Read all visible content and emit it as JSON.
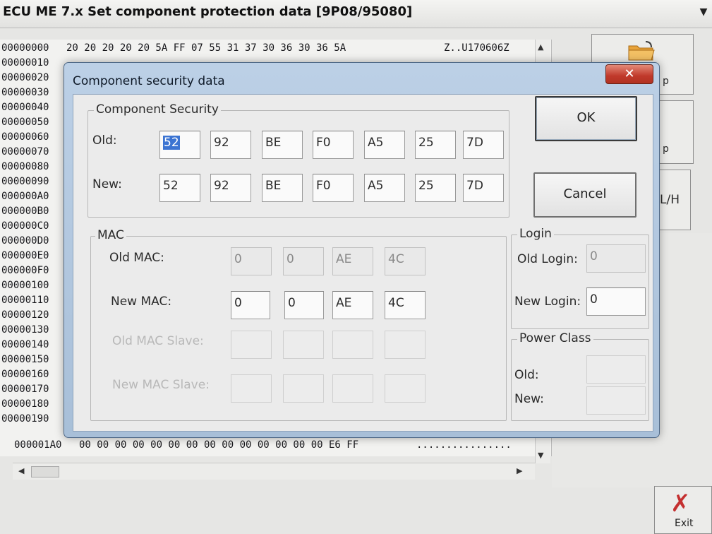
{
  "app": {
    "title": "ECU ME 7.x Set component protection data [9P08/95080]",
    "side_buttons": [
      {
        "label": "p"
      },
      {
        "label": "p"
      },
      {
        "label": "L/H"
      }
    ],
    "exit_label": "Exit"
  },
  "hex": {
    "rows": [
      {
        "addr": "00000000",
        "bytes": "20 20 20 20 20 5A FF 07 55 31 37 30 36 30 36 5A",
        "ascii": "Z..U170606Z"
      },
      {
        "addr": "00000010",
        "bytes": "",
        "ascii": ""
      },
      {
        "addr": "00000020",
        "bytes": "",
        "ascii": ""
      },
      {
        "addr": "00000030",
        "bytes": "",
        "ascii": ""
      },
      {
        "addr": "00000040",
        "bytes": "",
        "ascii": ""
      },
      {
        "addr": "00000050",
        "bytes": "",
        "ascii": ""
      },
      {
        "addr": "00000060",
        "bytes": "",
        "ascii": ""
      },
      {
        "addr": "00000070",
        "bytes": "",
        "ascii": ""
      },
      {
        "addr": "00000080",
        "bytes": "",
        "ascii": ""
      },
      {
        "addr": "00000090",
        "bytes": "",
        "ascii": ""
      },
      {
        "addr": "000000A0",
        "bytes": "",
        "ascii": ""
      },
      {
        "addr": "000000B0",
        "bytes": "",
        "ascii": ""
      },
      {
        "addr": "000000C0",
        "bytes": "",
        "ascii": ""
      },
      {
        "addr": "000000D0",
        "bytes": "",
        "ascii": ""
      },
      {
        "addr": "000000E0",
        "bytes": "",
        "ascii": ""
      },
      {
        "addr": "000000F0",
        "bytes": "",
        "ascii": ""
      },
      {
        "addr": "00000100",
        "bytes": "",
        "ascii": ""
      },
      {
        "addr": "00000110",
        "bytes": "",
        "ascii": ""
      },
      {
        "addr": "00000120",
        "bytes": "",
        "ascii": ""
      },
      {
        "addr": "00000130",
        "bytes": "",
        "ascii": ""
      },
      {
        "addr": "00000140",
        "bytes": "",
        "ascii": ""
      },
      {
        "addr": "00000150",
        "bytes": "",
        "ascii": ""
      },
      {
        "addr": "00000160",
        "bytes": "",
        "ascii": ""
      },
      {
        "addr": "00000170",
        "bytes": "",
        "ascii": ""
      },
      {
        "addr": "00000180",
        "bytes": "",
        "ascii": ""
      },
      {
        "addr": "00000190",
        "bytes": "",
        "ascii": ""
      },
      {
        "addr": "000001A0",
        "bytes": "00 00 00 00 00 00 00 00 00 00 00 00 00 00 E6 FF",
        "ascii": "................"
      }
    ]
  },
  "dialog": {
    "title": "Component security data",
    "close_label": "✕",
    "component_security": {
      "title": "Component Security",
      "old_label": "Old:",
      "new_label": "New:",
      "old_values": [
        "52",
        "92",
        "BE",
        "F0",
        "A5",
        "25",
        "7D"
      ],
      "new_values": [
        "52",
        "92",
        "BE",
        "F0",
        "A5",
        "25",
        "7D"
      ]
    },
    "mac": {
      "title": "MAC",
      "old_mac_label": "Old MAC:",
      "new_mac_label": "New MAC:",
      "old_mac_slave_label": "Old MAC Slave:",
      "new_mac_slave_label": "New MAC Slave:",
      "old_mac_values": [
        "0",
        "0",
        "AE",
        "4C"
      ],
      "new_mac_values": [
        "0",
        "0",
        "AE",
        "4C"
      ]
    },
    "login": {
      "title": "Login",
      "old_label": "Old Login:",
      "new_label": "New Login:",
      "old_value": "0",
      "new_value": "0"
    },
    "power_class": {
      "title": "Power Class",
      "old_label": "Old:",
      "new_label": "New:"
    },
    "ok_label": "OK",
    "cancel_label": "Cancel"
  }
}
